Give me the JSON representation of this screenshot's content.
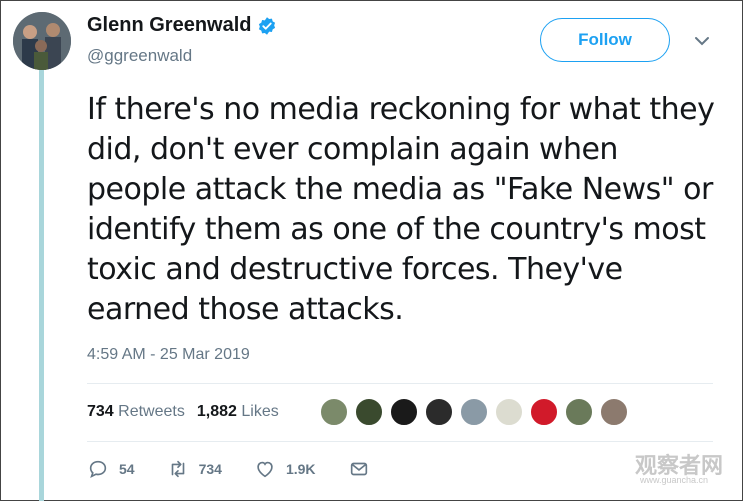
{
  "tweet": {
    "display_name": "Glenn Greenwald",
    "handle": "@ggreenwald",
    "follow_label": "Follow",
    "text": "If there's no media reckoning for what they did, don't ever complain again when people attack the media as \"Fake News\" or identify them as one of the country's most toxic and destructive forces. They've earned those attacks.",
    "timestamp": "4:59 AM - 25 Mar 2019"
  },
  "stats": {
    "retweets_count": "734",
    "retweets_label": "Retweets",
    "likes_count": "1,882",
    "likes_label": "Likes"
  },
  "actions": {
    "reply_count": "54",
    "retweet_count": "734",
    "like_count": "1.9K"
  },
  "watermark": {
    "text": "观察者网",
    "url": "www.guancha.cn"
  },
  "colors": {
    "accent": "#1da1f2",
    "muted": "#657786",
    "thread_line": "#a9d6db",
    "liker_avatars": [
      "#7b8a6a",
      "#3a4a2e",
      "#1a1a1a",
      "#2b2b2b",
      "#8a9aa6",
      "#dcdcd0",
      "#d11a2a",
      "#6a7a5a",
      "#8c7a6e"
    ]
  }
}
